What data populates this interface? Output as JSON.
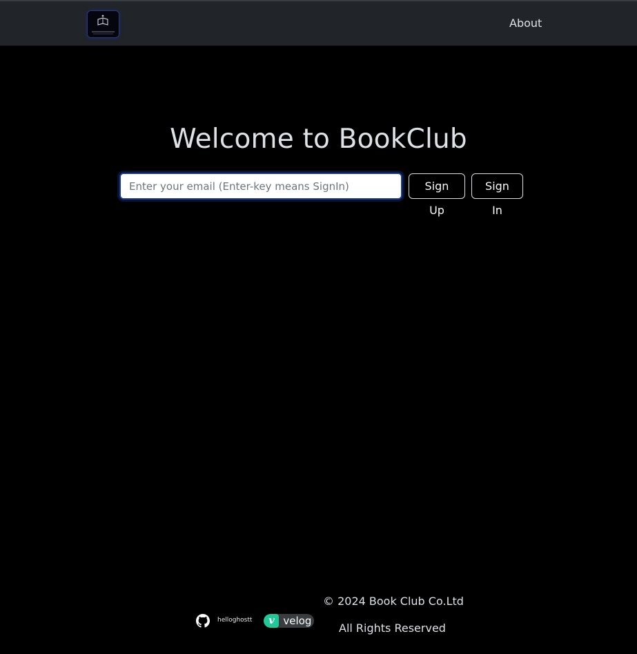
{
  "navbar": {
    "logo_icon": "bookclub-logo-icon",
    "logo_text": "BOOKCLUB",
    "about_label": "About",
    "background": "#212529"
  },
  "hero": {
    "title": "Welcome to BookClub"
  },
  "signin_form": {
    "email_placeholder": "Enter your email (Enter-key means SignIn)",
    "email_value": "",
    "signup_label": "Sign Up",
    "signin_label": "Sign In",
    "focus_color": "#1a3a9a"
  },
  "footer": {
    "github_icon": "github-icon",
    "github_username": "helloghostt",
    "velog_icon": "velog-icon",
    "velog_letter": "v",
    "velog_label": "velog",
    "velog_color": "#20c997",
    "copyright": "© 2024 Book Club Co.Ltd",
    "rights": "All Rights Reserved"
  }
}
